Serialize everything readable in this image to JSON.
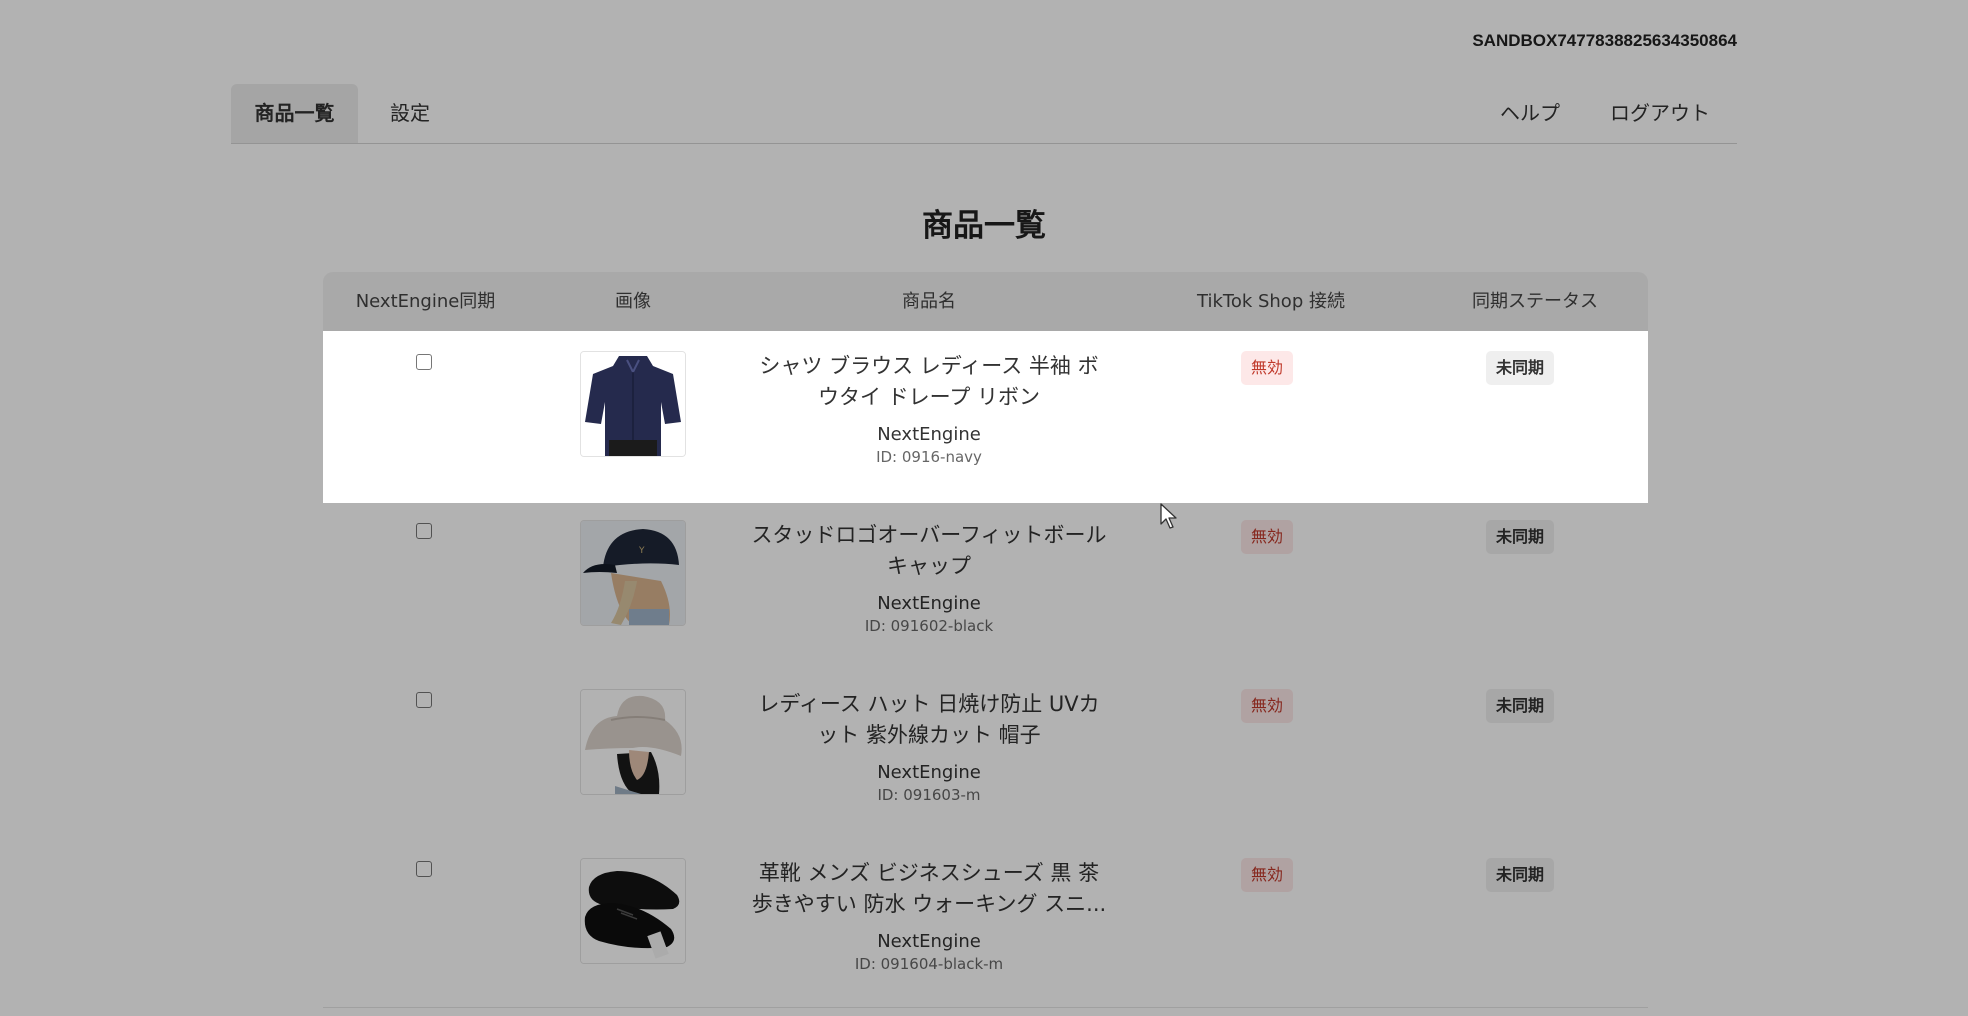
{
  "header": {
    "store_id": "SANDBOX7477838825634350864",
    "nav": {
      "products": "商品一覧",
      "settings": "設定",
      "help": "ヘルプ",
      "logout": "ログアウト"
    }
  },
  "page": {
    "title": "商品一覧"
  },
  "table": {
    "columns": [
      "NextEngine同期",
      "画像",
      "商品名",
      "TikTok Shop 接続",
      "同期ステータス"
    ],
    "rows": [
      {
        "name": "シャツ ブラウス レディース 半袖 ボウタイ ドレープ リボン",
        "source": "NextEngine",
        "id": "ID: 0916-navy",
        "tiktok": "無効",
        "sync": "未同期",
        "image": "navy-blouse"
      },
      {
        "name": "スタッドロゴオーバーフィットボールキャップ",
        "source": "NextEngine",
        "id": "ID: 091602-black",
        "tiktok": "無効",
        "sync": "未同期",
        "image": "black-cap"
      },
      {
        "name": "レディース ハット 日焼け防止 UVカット 紫外線カット 帽子",
        "source": "NextEngine",
        "id": "ID: 091603-m",
        "tiktok": "無効",
        "sync": "未同期",
        "image": "beige-hat"
      },
      {
        "name": "革靴 メンズ ビジネスシューズ 黒 茶 歩きやすい 防水 ウォーキング スニ...",
        "source": "NextEngine",
        "id": "ID: 091604-black-m",
        "tiktok": "無効",
        "sync": "未同期",
        "image": "black-shoes"
      }
    ]
  }
}
